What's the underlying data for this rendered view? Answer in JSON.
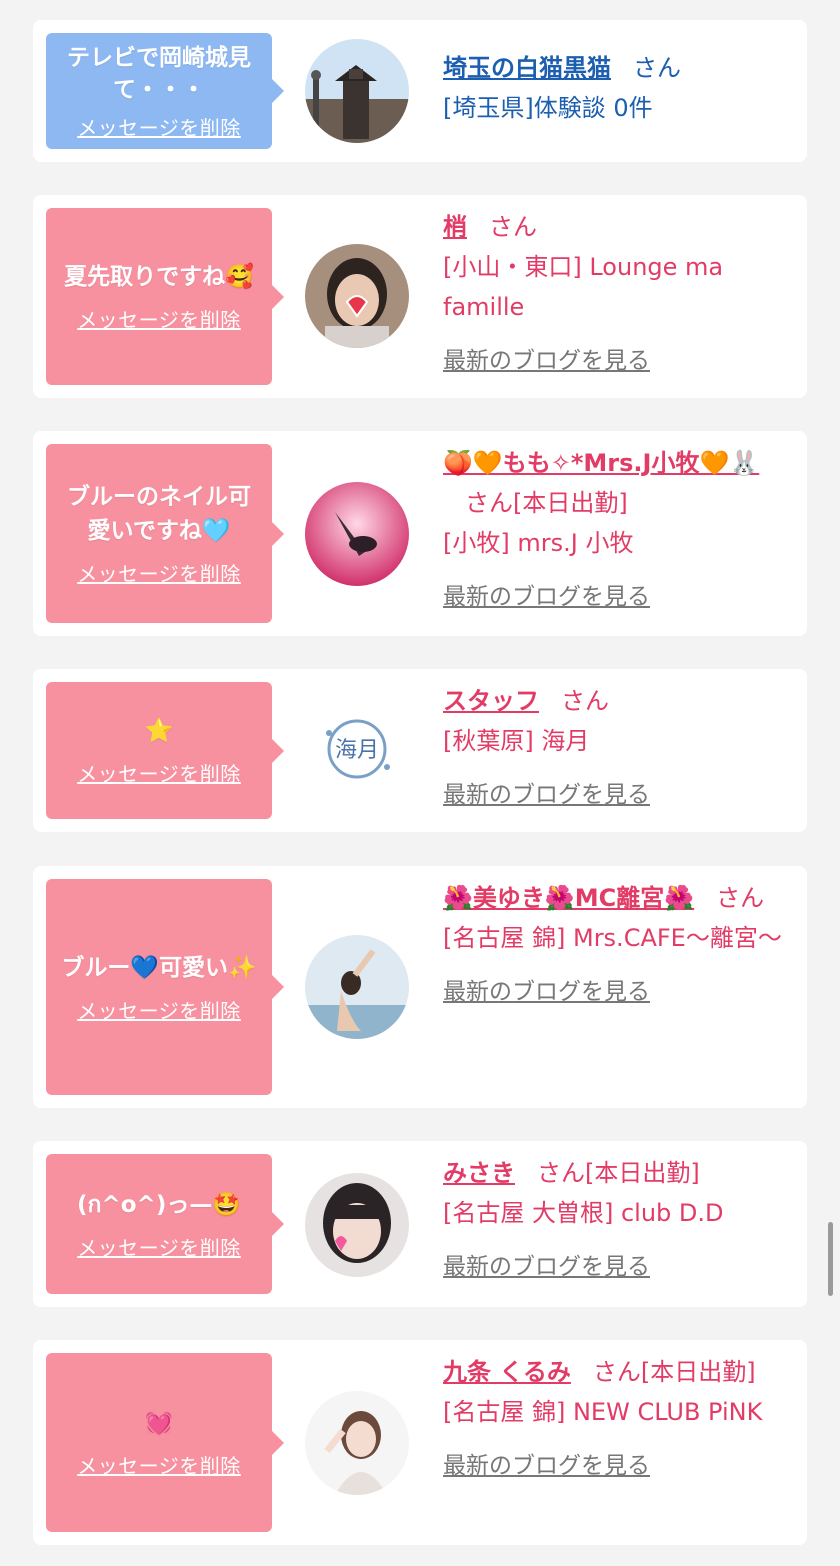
{
  "common": {
    "delete_label": "メッセージを削除",
    "san": "さん",
    "blog_label": "最新のブログを見る",
    "shukkin": "[本日出勤]"
  },
  "colors": {
    "pink": "#f7909f",
    "blue": "#8db8f2",
    "name_pink": "#e23c66",
    "name_blue": "#1c5fb0"
  },
  "items": [
    {
      "message": "テレビで岡崎城見て・・・",
      "name": "埼玉の白猫黒猫",
      "shop": "[埼玉県]体験談 0件"
    },
    {
      "message": "夏先取りですね🥰",
      "name": "梢",
      "shop": "[小山・東口] Lounge ma famille"
    },
    {
      "message": "ブルーのネイル可愛いですね🩵",
      "name": "🍑🧡もも✧*Mrs.J小牧🧡🐰",
      "shop": "[小牧] mrs.J 小牧"
    },
    {
      "message": "⭐️",
      "name": "スタッフ",
      "shop": "[秋葉原] 海月"
    },
    {
      "message": "ブルー💙可愛い✨",
      "name": "🌺美ゆき🌺MC離宮🌺",
      "shop": "[名古屋 錦] Mrs.CAFE～離宮～"
    },
    {
      "message": "(ก^o^)っ—🤩",
      "name": "みさき",
      "shop": "[名古屋 大曽根] club D.D"
    },
    {
      "message": "💓",
      "name": "九条 くるみ",
      "shop": "[名古屋 錦] NEW CLUB PiNK"
    }
  ]
}
